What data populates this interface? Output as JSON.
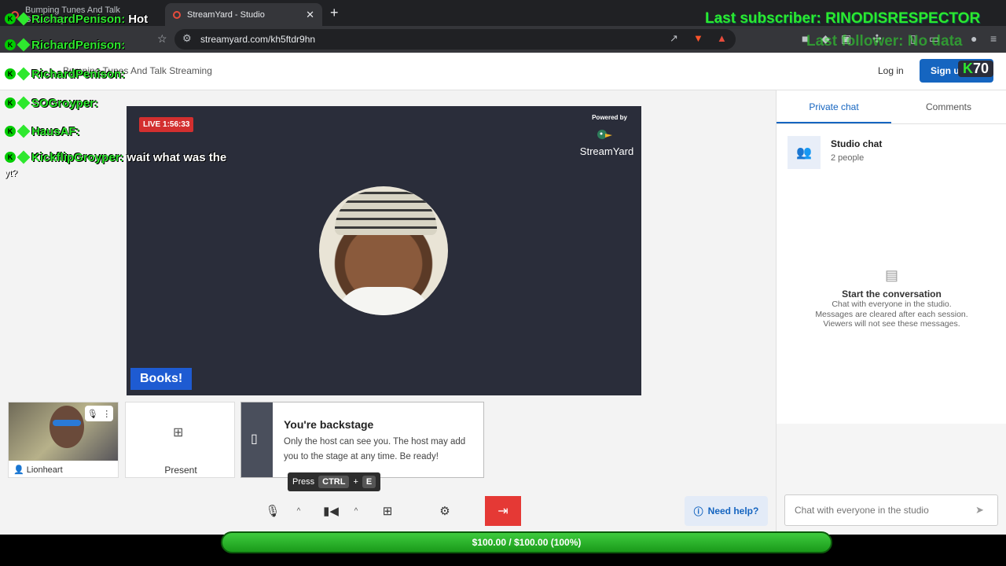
{
  "browser": {
    "tab_inactive": "Bumping Tunes And Talk Streaming",
    "tab_active": "StreamYard - Studio",
    "tab_close": "✕",
    "new_tab": "+",
    "url": "streamyard.com/kh5ftdr9hn"
  },
  "header": {
    "broadcast_title": "Bumping Tunes And Talk Streaming",
    "login": "Log in",
    "signup": "Sign up free"
  },
  "stage": {
    "live_badge": "LIVE 1:56:33",
    "powered_by": "Powered by",
    "brand": "StreamYard",
    "banner": "Books!"
  },
  "guests": {
    "guest_name": "Lionheart",
    "present_label": "Present",
    "backstage_title": "You're backstage",
    "backstage_desc": "Only the host can see you. The host may add you to the stage at any time. Be ready!"
  },
  "tooltip": {
    "press": "Press",
    "key1": "CTRL",
    "plus": "+",
    "key2": "E"
  },
  "controls": {
    "need_help": "Need help?"
  },
  "panel": {
    "tab_private": "Private chat",
    "tab_comments": "Comments",
    "studio_chat": "Studio chat",
    "people": "2 people",
    "empty_heading": "Start the conversation",
    "empty_line1": "Chat with everyone in the studio.",
    "empty_line2": "Messages are cleared after each session.",
    "empty_line3": "Viewers will not see these messages.",
    "chat_placeholder": "Chat with everyone in the studio"
  },
  "overlay": {
    "last_subscriber": "Last subscriber: RINODISRESPECTOR",
    "last_follower": "Last follower: No data",
    "k_badge": "K",
    "k_count": "70",
    "goal": "$100.00 / $100.00 (100%)",
    "chat": [
      {
        "user": "RichardPenison:",
        "msg": "Hot"
      },
      {
        "user": "RichardPenison:",
        "msg": ""
      },
      {
        "user": "RichardPenison:",
        "msg": ""
      },
      {
        "user": "SOGroyper:",
        "msg": ""
      },
      {
        "user": "HausAF:",
        "msg": ""
      },
      {
        "user": "KickflipGroyper:",
        "msg": "wait what was the"
      }
    ],
    "chat_extra": "yt?"
  },
  "colors": {
    "accent": "#1565c0",
    "live": "#d32f2f",
    "leave": "#e53935",
    "overlay_green": "#2ee82e"
  }
}
